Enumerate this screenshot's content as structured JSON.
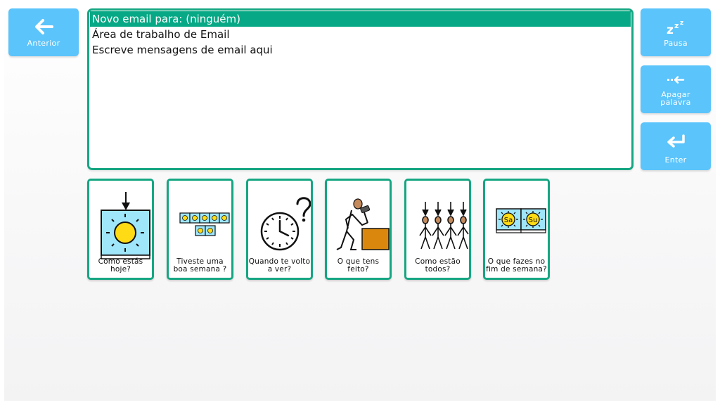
{
  "nav": {
    "anterior_label": "Anterior",
    "pausa_label": "Pausa",
    "apagar_label": "Apagar palavra",
    "enter_label": "Enter"
  },
  "editor": {
    "lines": [
      "Novo email para: (ninguém)",
      "Área de trabalho de Email",
      "Escreve mensagens de email aqui"
    ]
  },
  "cards": [
    {
      "label": "Como estás hoje?",
      "icon": "sun-icon"
    },
    {
      "label": "Tiveste uma boa semana ?",
      "icon": "week-calendar-icon"
    },
    {
      "label": "Quando te volto a ver?",
      "icon": "clock-question-icon"
    },
    {
      "label": "O que tens feito?",
      "icon": "person-hammer-icon"
    },
    {
      "label": "Como estão todos?",
      "icon": "group-people-icon"
    },
    {
      "label": "O que fazes no fim de semana?",
      "icon": "weekend-sa-su-icon"
    }
  ],
  "weekend_tiles": [
    "Sa",
    "Su"
  ],
  "colors": {
    "button": "#5bc4fb",
    "border": "#15a682",
    "selection": "#07a885",
    "sun": "#ffdb15",
    "sky": "#9fe6fb",
    "box": "#d9880d"
  }
}
